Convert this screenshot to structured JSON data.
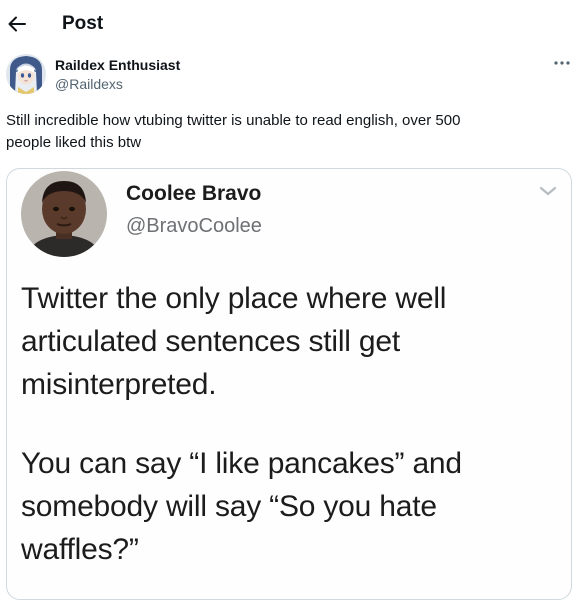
{
  "header": {
    "back_icon": "arrow-left-icon",
    "title": "Post"
  },
  "post": {
    "author": {
      "name": "Raildex Enthusiast",
      "handle": "@Raildexs",
      "avatar_icon": "anime-character-avatar"
    },
    "more_icon": "ellipsis-icon",
    "text_lines": [
      "Still incredible how vtubing twitter is unable to read english, over 500",
      "people liked this btw"
    ],
    "media": {
      "type": "embedded-tweet-screenshot",
      "author_name": "Coolee Bravo",
      "author_handle": "@BravoCoolee",
      "chevron_icon": "chevron-down-icon",
      "paragraph1_lines": [
        "Twitter the only place where well",
        "articulated sentences still get",
        "misinterpreted."
      ],
      "paragraph2_lines": [
        "You can say “I like pancakes” and",
        "somebody will say “So you hate",
        "waffles?”"
      ]
    }
  },
  "colors": {
    "text_primary": "#0f1419",
    "text_secondary": "#536471",
    "border": "#cfd9de",
    "background": "#ffffff"
  }
}
